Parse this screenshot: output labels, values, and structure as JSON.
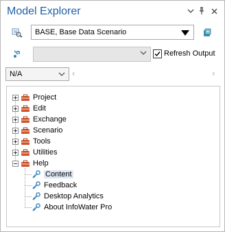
{
  "window": {
    "title": "Model Explorer",
    "dropdown_icon": "chevron-down-icon",
    "pin_icon": "pin-icon",
    "close_icon": "close-icon"
  },
  "scenario": {
    "selected": "BASE, Base Data Scenario"
  },
  "output": {
    "selected": "",
    "refresh_label": "Refresh Output",
    "refresh_checked": true
  },
  "filter": {
    "selected": "N/A"
  },
  "tree": {
    "items": [
      {
        "label": "Project",
        "expanded": false
      },
      {
        "label": "Edit",
        "expanded": false
      },
      {
        "label": "Exchange",
        "expanded": false
      },
      {
        "label": "Scenario",
        "expanded": false
      },
      {
        "label": "Tools",
        "expanded": false
      },
      {
        "label": "Utilities",
        "expanded": false
      },
      {
        "label": "Help",
        "expanded": true,
        "children": [
          {
            "label": "Content"
          },
          {
            "label": "Feedback"
          },
          {
            "label": "Desktop Analytics"
          },
          {
            "label": "About InfoWater Pro"
          }
        ]
      }
    ]
  },
  "colors": {
    "title": "#1f5fa8",
    "toolbox": "#d2542a",
    "leaf": "#4a90c8"
  }
}
